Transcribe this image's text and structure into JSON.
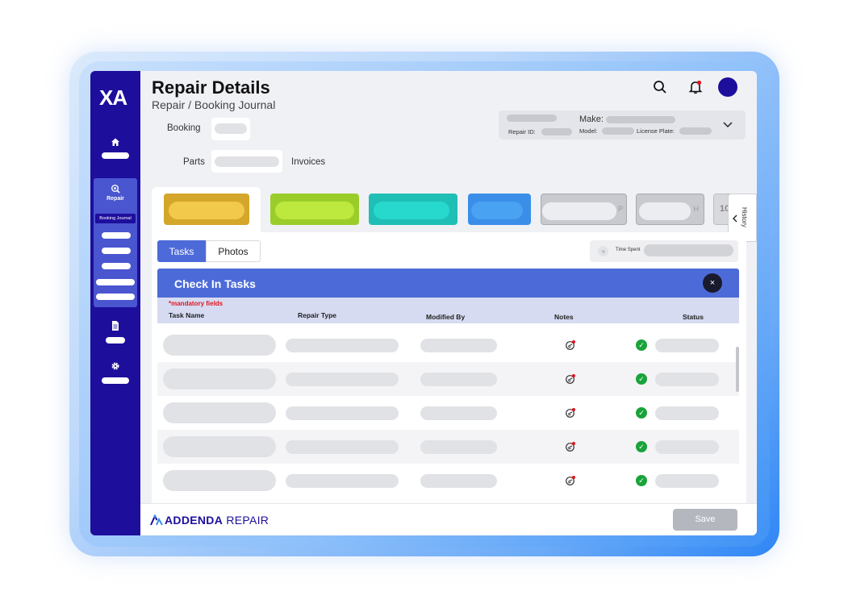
{
  "app": {
    "logo": "XA",
    "title": "Repair Details",
    "breadcrumb": "Repair / Booking Journal"
  },
  "sidebar": {
    "items": [
      {
        "icon": "home-icon"
      },
      {
        "icon": "repair-icon",
        "label": "Repair",
        "active": true,
        "sub_label": "Booking Journal"
      },
      {
        "icon": "document-icon"
      },
      {
        "icon": "gear-icon"
      }
    ]
  },
  "header": {
    "icons": [
      "search-icon",
      "bell-icon",
      "avatar"
    ],
    "vehicle": {
      "make_label": "Make:",
      "repair_id_label": "Repair ID:",
      "model_label": "Model:",
      "license_plate_label": "License Plate:"
    }
  },
  "subnav": {
    "booking_label": "Booking",
    "parts_label": "Parts",
    "invoices_label": "Invoices"
  },
  "status_tabs": {
    "colors": [
      "#d4a62a",
      "#9acd2a",
      "#1fbfb6",
      "#3b8ee8",
      "#c9cacf",
      "#c9cacf",
      "#d8d9dd"
    ],
    "partial_text": [
      "P",
      "H",
      "10"
    ]
  },
  "history": {
    "label": "History"
  },
  "tabs": {
    "tasks_label": "Tasks",
    "photos_label": "Photos",
    "time_spent_label": "Time Spent"
  },
  "panel": {
    "title": "Check In Tasks",
    "mandatory": "*mandatory fields",
    "columns": {
      "task_name": "Task Name",
      "repair_type": "Repair Type",
      "modified_by": "Modified By",
      "notes": "Notes",
      "status": "Status"
    },
    "close_symbol": "×"
  },
  "footer": {
    "brand_bold": "ADDENDA",
    "brand_light": "REPAIR",
    "save_label": "Save"
  },
  "colors": {
    "sidebar": "#1e0e9c",
    "panel_header": "#4d6bd8",
    "status_ok": "#1aa33a",
    "mandatory": "#e0151f"
  }
}
